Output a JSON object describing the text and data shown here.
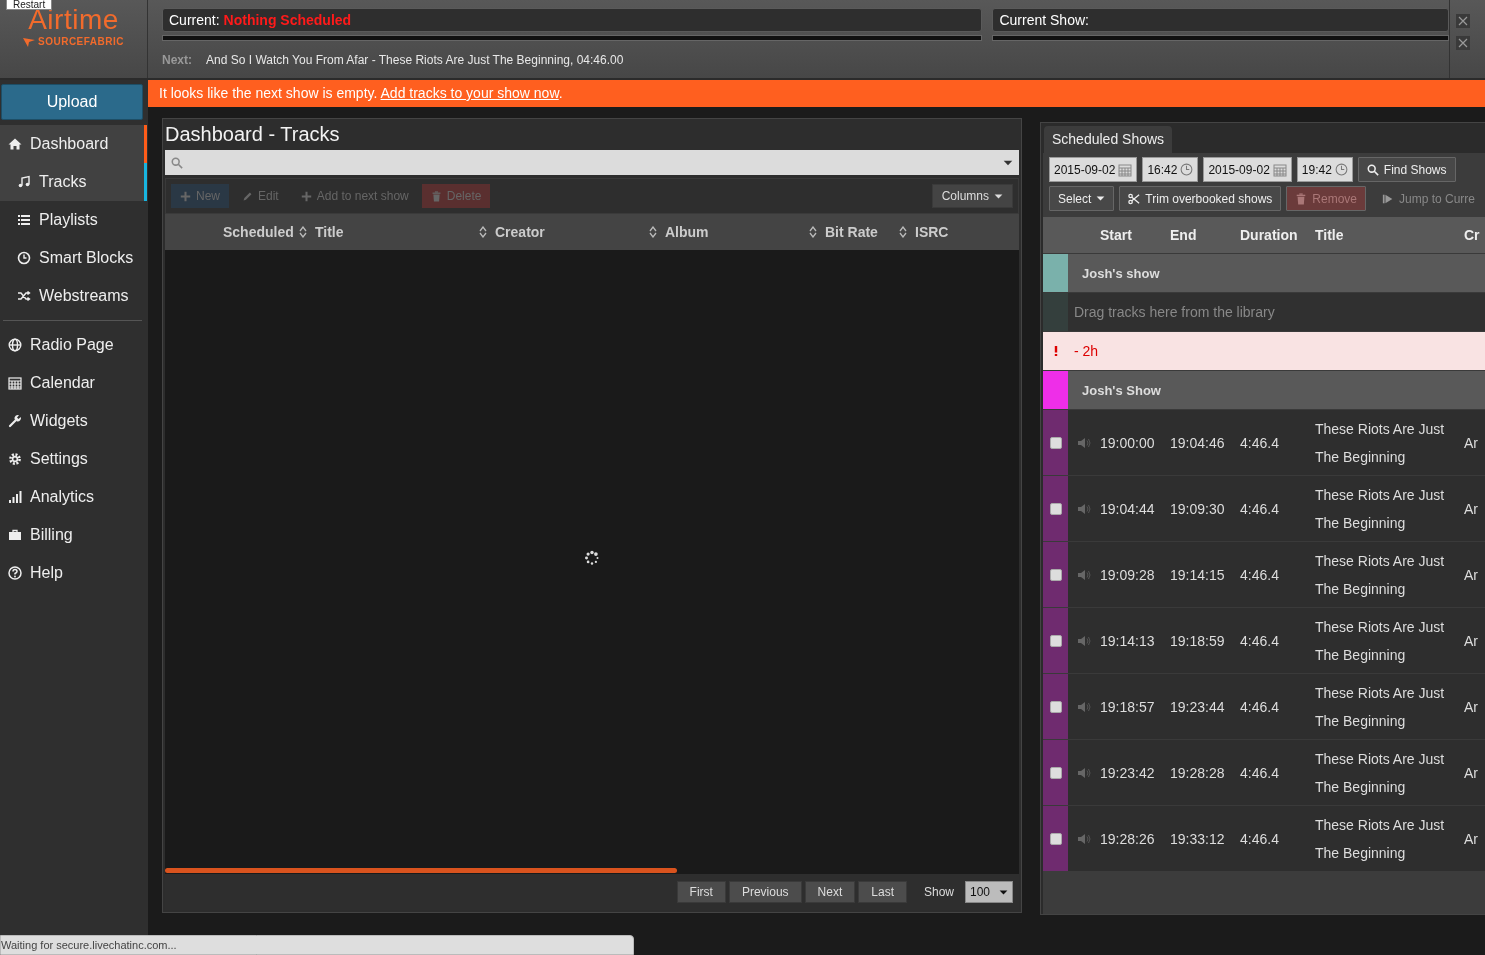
{
  "tooltip": "Restart",
  "logo": {
    "name": "Airtime",
    "vendor": "SOURCEFABRIC"
  },
  "now_playing": {
    "current_label": "Current:",
    "current_value": "Nothing Scheduled",
    "current_progress": {
      "level": 0
    },
    "show_label": "Current Show:",
    "show_progress": {
      "level": 0
    },
    "next_label": "Next:",
    "next_value": "And So I Watch You From Afar - These Riots Are Just The Beginning, 04:46.00"
  },
  "banner": {
    "text": "It looks like the next show is empty. ",
    "link": "Add tracks to your show now",
    "tail": "."
  },
  "sidebar": {
    "upload": "Upload",
    "items": [
      {
        "label": "Dashboard",
        "selected": true,
        "expanded": true,
        "children": [
          {
            "label": "Tracks",
            "selected": true
          },
          {
            "label": "Playlists",
            "selected": false
          },
          {
            "label": "Smart Blocks",
            "selected": false
          },
          {
            "label": "Webstreams",
            "selected": false
          }
        ]
      },
      {
        "label": "Radio Page",
        "selected": false
      },
      {
        "label": "Calendar",
        "selected": false
      },
      {
        "label": "Widgets",
        "selected": false
      },
      {
        "label": "Settings",
        "selected": false
      },
      {
        "label": "Analytics",
        "selected": false
      },
      {
        "label": "Billing",
        "selected": false
      },
      {
        "label": "Help",
        "selected": false
      }
    ]
  },
  "tracks": {
    "title": "Dashboard - Tracks",
    "toolbar": [
      {
        "label": "New",
        "kind": "new",
        "disabled": true
      },
      {
        "label": "Edit",
        "kind": "edit",
        "disabled": true
      },
      {
        "label": "Add to next show",
        "kind": "add",
        "disabled": true
      },
      {
        "label": "Delete",
        "kind": "delete",
        "disabled": true
      }
    ],
    "columns_button": "Columns",
    "columns": [
      {
        "label": "Scheduled",
        "sortable": true
      },
      {
        "label": "Title",
        "sortable": true
      },
      {
        "label": "Creator",
        "sortable": true
      },
      {
        "label": "Album",
        "sortable": true
      },
      {
        "label": "Bit Rate",
        "sortable": true
      },
      {
        "label": "ISRC",
        "sortable": false
      }
    ],
    "pagination": [
      "First",
      "Previous",
      "Next",
      "Last"
    ],
    "show_label": "Show",
    "page_size": "100"
  },
  "schedule": {
    "tabs": [
      {
        "label": "Scheduled Shows",
        "selected": true
      }
    ],
    "range": [
      {
        "value": "2015-09-02",
        "kind": "date"
      },
      {
        "value": "16:42",
        "kind": "time"
      },
      {
        "value": "2015-09-02",
        "kind": "date"
      },
      {
        "value": "19:42",
        "kind": "time"
      }
    ],
    "find": "Find Shows",
    "toolbar": [
      {
        "label": "Select",
        "kind": "select",
        "disabled": false
      },
      {
        "label": "Trim overbooked shows",
        "kind": "trim",
        "disabled": false
      },
      {
        "label": "Remove",
        "kind": "remove",
        "disabled": true
      },
      {
        "label": "Jump to Curre",
        "kind": "jump",
        "disabled": true
      }
    ],
    "columns": [
      "Start",
      "End",
      "Duration",
      "Title",
      "Cr"
    ],
    "rows": [
      {
        "kind": "show",
        "name": "Josh's show",
        "color": "#7ab1ab"
      },
      {
        "kind": "empty",
        "text": "Drag tracks here from the library",
        "color": "#343f3d"
      },
      {
        "kind": "warning",
        "text": "- 2h"
      },
      {
        "kind": "show",
        "name": "Josh's Show",
        "color": "#ee2ee8"
      },
      {
        "kind": "track",
        "checked": false,
        "color": "#6f2b6f",
        "start": "19:00:00",
        "end": "19:04:46",
        "duration": "4:46.4",
        "title": "These Riots Are Just The Beginning",
        "column_5": "Ar"
      },
      {
        "kind": "track",
        "checked": false,
        "color": "#6f2b6f",
        "start": "19:04:44",
        "end": "19:09:30",
        "duration": "4:46.4",
        "title": "These Riots Are Just The Beginning",
        "column_5": "Ar"
      },
      {
        "kind": "track",
        "checked": false,
        "color": "#6f2b6f",
        "start": "19:09:28",
        "end": "19:14:15",
        "duration": "4:46.4",
        "title": "These Riots Are Just The Beginning",
        "column_5": "Ar"
      },
      {
        "kind": "track",
        "checked": false,
        "color": "#6f2b6f",
        "start": "19:14:13",
        "end": "19:18:59",
        "duration": "4:46.4",
        "title": "These Riots Are Just The Beginning",
        "column_5": "Ar"
      },
      {
        "kind": "track",
        "checked": false,
        "color": "#6f2b6f",
        "start": "19:18:57",
        "end": "19:23:44",
        "duration": "4:46.4",
        "title": "These Riots Are Just The Beginning",
        "column_5": "Ar"
      },
      {
        "kind": "track",
        "checked": false,
        "color": "#6f2b6f",
        "start": "19:23:42",
        "end": "19:28:28",
        "duration": "4:46.4",
        "title": "These Riots Are Just The Beginning",
        "column_5": "Ar"
      },
      {
        "kind": "track",
        "checked": false,
        "color": "#6f2b6f",
        "start": "19:28:26",
        "end": "19:33:12",
        "duration": "4:46.4",
        "title": "These Riots Are Just The Beginning",
        "column_5": "Ar"
      }
    ]
  },
  "status": "Waiting for secure.livechatinc.com..."
}
